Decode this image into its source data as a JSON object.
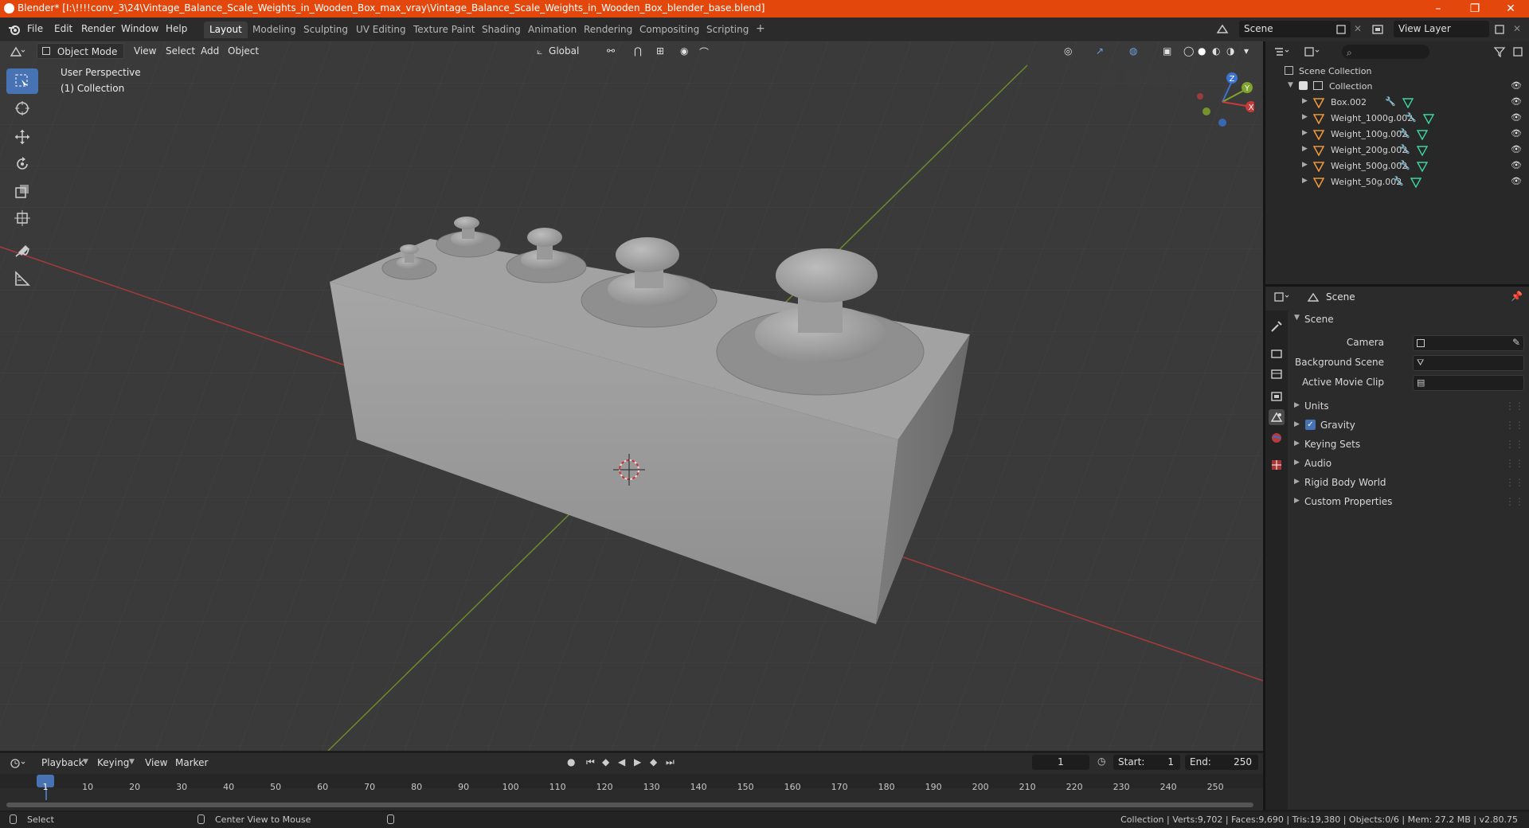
{
  "titlebar": {
    "title": "Blender* [I:\\!!!!conv_3\\24\\Vintage_Balance_Scale_Weights_in_Wooden_Box_max_vray\\Vintage_Balance_Scale_Weights_in_Wooden_Box_blender_base.blend]",
    "minimize": "–",
    "maximize": "❐",
    "close": "✕"
  },
  "menu": {
    "file": "File",
    "edit": "Edit",
    "render": "Render",
    "window": "Window",
    "help": "Help"
  },
  "workspaces": [
    "Layout",
    "Modeling",
    "Sculpting",
    "UV Editing",
    "Texture Paint",
    "Shading",
    "Animation",
    "Rendering",
    "Compositing",
    "Scripting"
  ],
  "add_workspace": "+",
  "scene_field": "Scene",
  "view_layer_field": "View Layer",
  "viewport_header": {
    "mode": "Object Mode",
    "view": "View",
    "select": "Select",
    "add": "Add",
    "object": "Object",
    "orientation": "Global"
  },
  "viewport_overlay": {
    "perspective": "User Perspective",
    "collection": "(1) Collection",
    "axis_x": "X",
    "axis_y": "Y",
    "axis_z": "Z"
  },
  "outliner": {
    "search_placeholder": "",
    "scene_collection": "Scene Collection",
    "collection": "Collection",
    "objects": [
      "Box.002",
      "Weight_1000g.002",
      "Weight_100g.002",
      "Weight_200g.002",
      "Weight_500g.002",
      "Weight_50g.002"
    ]
  },
  "properties": {
    "header": "Scene",
    "section": "Scene",
    "camera_label": "Camera",
    "background_scene_label": "Background Scene",
    "active_movie_clip_label": "Active Movie Clip",
    "panels": [
      "Units",
      "Gravity",
      "Keying Sets",
      "Audio",
      "Rigid Body World",
      "Custom Properties"
    ],
    "gravity_checked": true
  },
  "timeline": {
    "playback": "Playback",
    "keying": "Keying",
    "view": "View",
    "marker": "Marker",
    "current_frame": "1",
    "start_label": "Start:",
    "start": "1",
    "end_label": "End:",
    "end": "250",
    "ruler": [
      "1",
      "10",
      "20",
      "30",
      "40",
      "50",
      "60",
      "70",
      "80",
      "90",
      "100",
      "110",
      "120",
      "130",
      "140",
      "150",
      "160",
      "170",
      "180",
      "190",
      "200",
      "210",
      "220",
      "230",
      "240",
      "250"
    ]
  },
  "statusbar": {
    "select": "Select",
    "center_view": "Center View to Mouse",
    "stats": "Collection | Verts:9,702 | Faces:9,690 | Tris:19,380 | Objects:0/6 | Mem: 27.2 MB | v2.80.75"
  },
  "colors": {
    "title_bar": "#e3470b",
    "accent": "#4772b3",
    "object_icon": "#e8963c",
    "x_axis": "#c73a3a",
    "y_axis": "#7fa32b",
    "z_axis": "#3a73d1"
  }
}
